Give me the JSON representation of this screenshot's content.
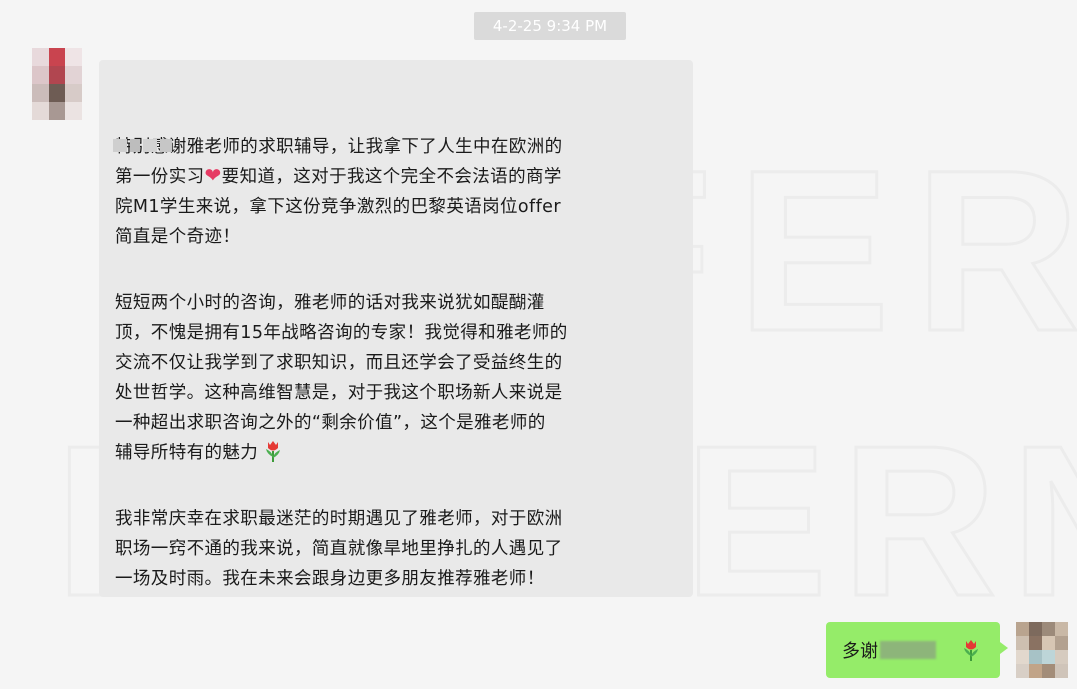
{
  "chat": {
    "timestamp": "4-2-25 9:34 PM",
    "incoming": {
      "sender_name": "",
      "paragraphs": [
        {
          "before_heart": "特别感谢雅老师的求职辅导，让我拿下了人生中在欧洲的\n第一份实习",
          "after_heart": "要知道，这对于我这个完全不会法语的商学\n院M1学生来说，拿下这份竞争激烈的巴黎英语岗位offer\n简直是个奇迹！"
        },
        {
          "text": "短短两个小时的咨询，雅老师的话对我来说犹如醍醐灌\n顶，不愧是拥有15年战略咨询的专家！我觉得和雅老师的\n交流不仅让我学到了求职知识，而且还学会了受益终生的\n处世哲学。这种高维智慧是，对于我这个职场新人来说是\n一种超出求职咨询之外的“剩余价值”，这个是雅老师的\n辅导所特有的魅力"
        },
        {
          "text": "我非常庆幸在求职最迷茫的时期遇见了雅老师，对于欧洲\n职场一窍不通的我来说，简直就像旱地里挣扎的人遇见了\n一场及时雨。我在未来会跟身边更多朋友推荐雅老师！"
        }
      ],
      "icons": [
        "heart-emoji-icon",
        "tulip-emoji-icon"
      ]
    },
    "outgoing": {
      "text": "多谢",
      "icons": [
        "tulip-emoji-icon"
      ]
    },
    "watermark": {
      "line1": "OFFER",
      "line2": "LANTERN"
    },
    "colors": {
      "background": "#f5f5f5",
      "incoming_bubble": "#e9e9e9",
      "outgoing_bubble": "#95ec69",
      "timestamp_bg": "#dadada"
    }
  }
}
